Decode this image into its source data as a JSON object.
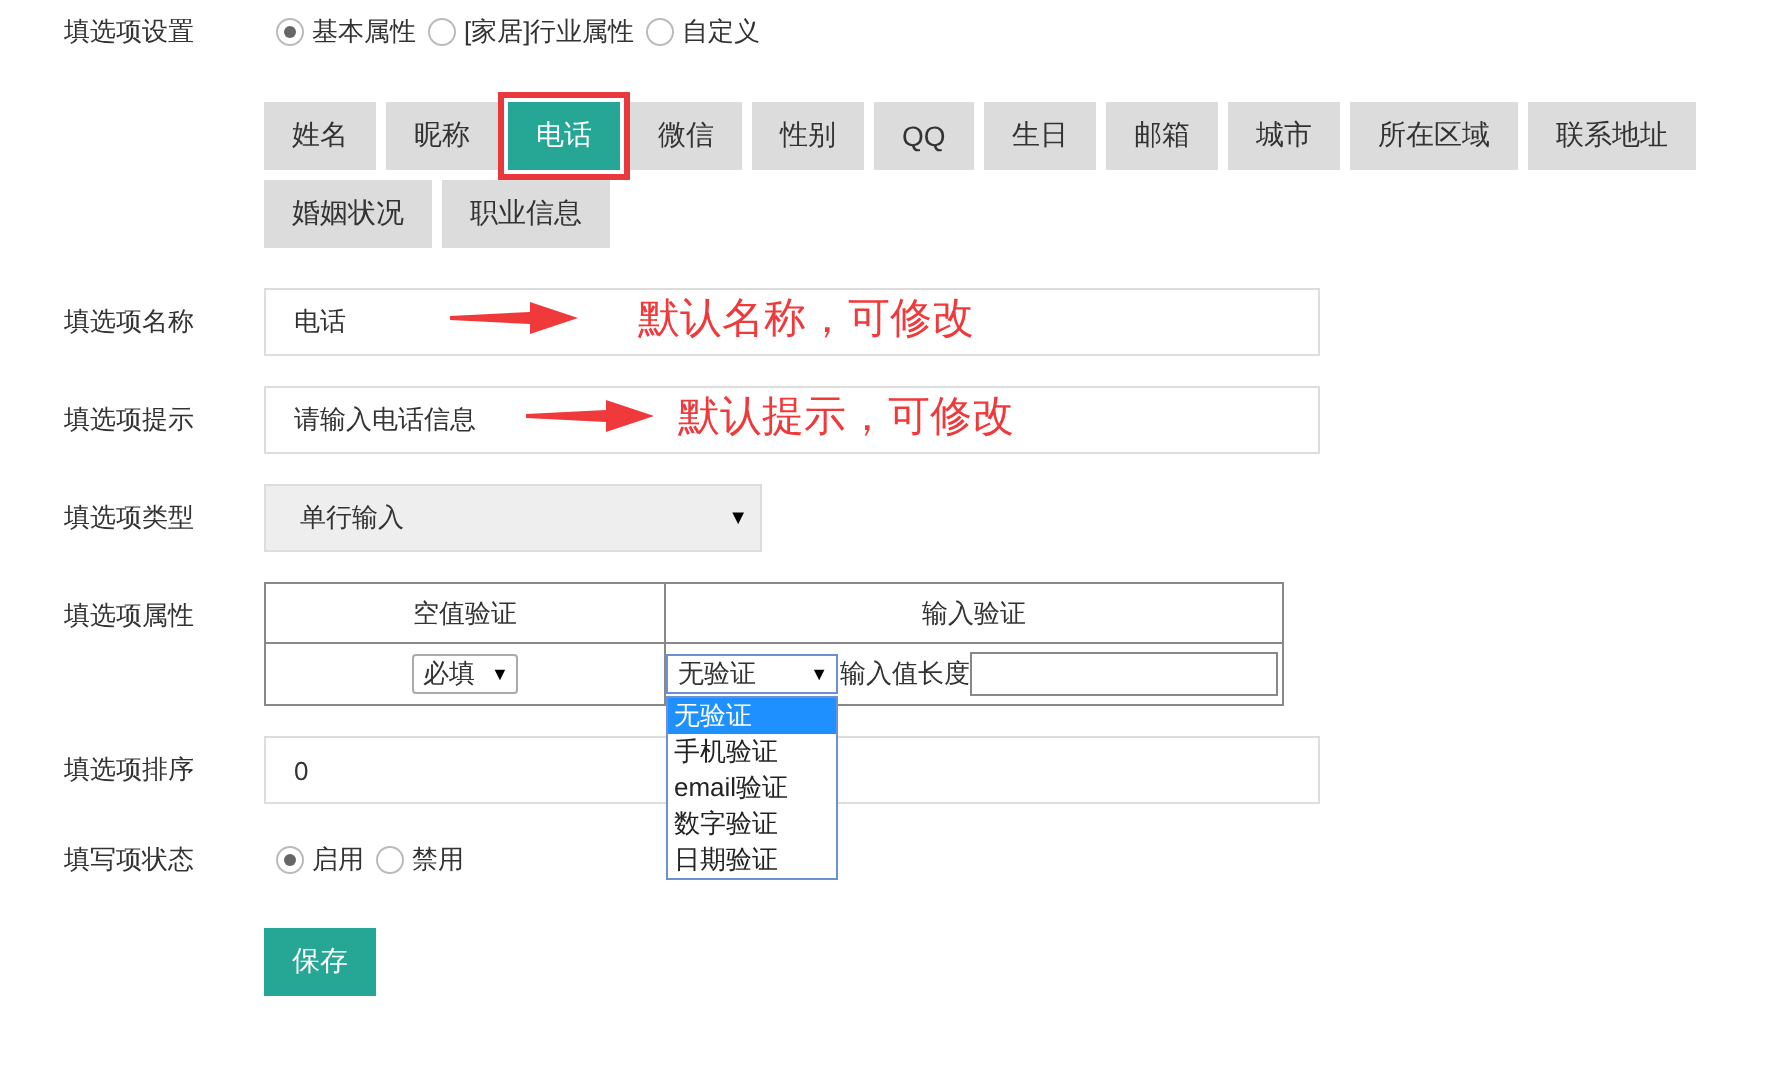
{
  "settings": {
    "label": "填选项设置",
    "options": [
      {
        "label": "基本属性",
        "selected": true
      },
      {
        "label": "[家居]行业属性",
        "selected": false
      },
      {
        "label": "自定义",
        "selected": false
      }
    ]
  },
  "tabs": [
    {
      "label": "姓名",
      "selected": false
    },
    {
      "label": "昵称",
      "selected": false
    },
    {
      "label": "电话",
      "selected": true
    },
    {
      "label": "微信",
      "selected": false
    },
    {
      "label": "性别",
      "selected": false
    },
    {
      "label": "QQ",
      "selected": false
    },
    {
      "label": "生日",
      "selected": false
    },
    {
      "label": "邮箱",
      "selected": false
    },
    {
      "label": "城市",
      "selected": false
    },
    {
      "label": "所在区域",
      "selected": false
    },
    {
      "label": "联系地址",
      "selected": false
    },
    {
      "label": "婚姻状况",
      "selected": false
    },
    {
      "label": "职业信息",
      "selected": false
    }
  ],
  "name_field": {
    "label": "填选项名称",
    "value": "电话",
    "annotation": "默认名称，可修改"
  },
  "hint_field": {
    "label": "填选项提示",
    "value": "请输入电话信息",
    "annotation": "默认提示，可修改"
  },
  "type_field": {
    "label": "填选项类型",
    "value": "单行输入",
    "arrow": "▼"
  },
  "attributes": {
    "label": "填选项属性",
    "columns": [
      "空值验证",
      "输入验证"
    ],
    "required_select": {
      "value": "必填",
      "arrow": "▼"
    },
    "validation_select": {
      "value": "无验证",
      "arrow": "▼",
      "expanded": true,
      "options": [
        {
          "label": "无验证",
          "selected": true
        },
        {
          "label": "手机验证",
          "selected": false
        },
        {
          "label": "email验证",
          "selected": false
        },
        {
          "label": "数字验证",
          "selected": false
        },
        {
          "label": "日期验证",
          "selected": false
        }
      ]
    },
    "length_label": "输入值长度"
  },
  "order_field": {
    "label": "填选项排序",
    "value": "0"
  },
  "status": {
    "label": "填写项状态",
    "options": [
      {
        "label": "启用",
        "selected": true
      },
      {
        "label": "禁用",
        "selected": false
      }
    ]
  },
  "save_button": "保存"
}
